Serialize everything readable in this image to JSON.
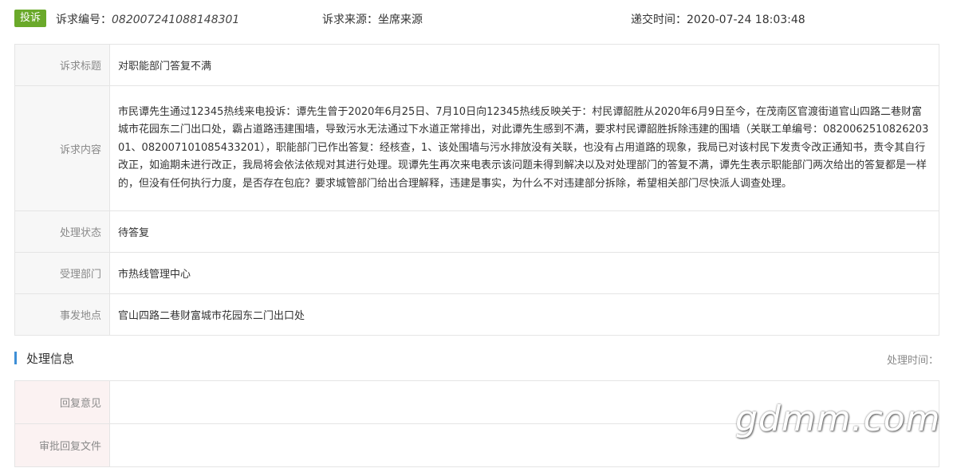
{
  "header": {
    "tag": "投诉",
    "case_no_label": "诉求编号：",
    "case_no": "082007241088148301",
    "source": "诉求来源：坐席来源",
    "submit_time": "递交时间：2020-07-24 18:03:48"
  },
  "details": {
    "title_label": "诉求标题",
    "title": "对职能部门答复不满",
    "content_label": "诉求内容",
    "content": "市民谭先生通过12345热线来电投诉：谭先生曾于2020年6月25日、7月10日向12345热线反映关于：村民谭韶胜从2020年6月9日至今，在茂南区官渡街道官山四路二巷财富城市花园东二门出口处，霸占道路违建围墙，导致污水无法通过下水道正常排出，对此谭先生感到不满，要求村民谭韶胜拆除违建的围墙（关联工单编号：082006251082620301、082007101085433201），职能部门已作出答复：经核查，1、该处围墙与污水排放没有关联，也没有占用道路的现象，我局已对该村民下发责令改正通知书，责令其自行改正，如逾期未进行改正，我局将会依法依规对其进行处理。现谭先生再次来电表示该问题未得到解决以及对处理部门的答复不满，谭先生表示职能部门两次给出的答复都是一样的，但没有任何执行力度，是否存在包庇？要求城管部门给出合理解释，违建是事实，为什么不对违建部分拆除，希望相关部门尽快派人调查处理。",
    "status_label": "处理状态",
    "status": "待答复",
    "dept_label": "受理部门",
    "dept": "市热线管理中心",
    "location_label": "事发地点",
    "location": "官山四路二巷财富城市花园东二门出口处"
  },
  "processing": {
    "section_title": "处理信息",
    "time_label": "处理时间：",
    "reply_opinion_label": "回复意见",
    "reply_opinion": "",
    "approval_file_label": "审批回复文件",
    "approval_file": ""
  },
  "watermark": "gdmm.com",
  "colors": {
    "tag_green": "#6aa92a",
    "status_green": "#5a9e2f",
    "section_bar_blue": "#3e8fd6",
    "label_bg": "#f7f7f7",
    "reply_label_bg": "#fbf2f2"
  }
}
